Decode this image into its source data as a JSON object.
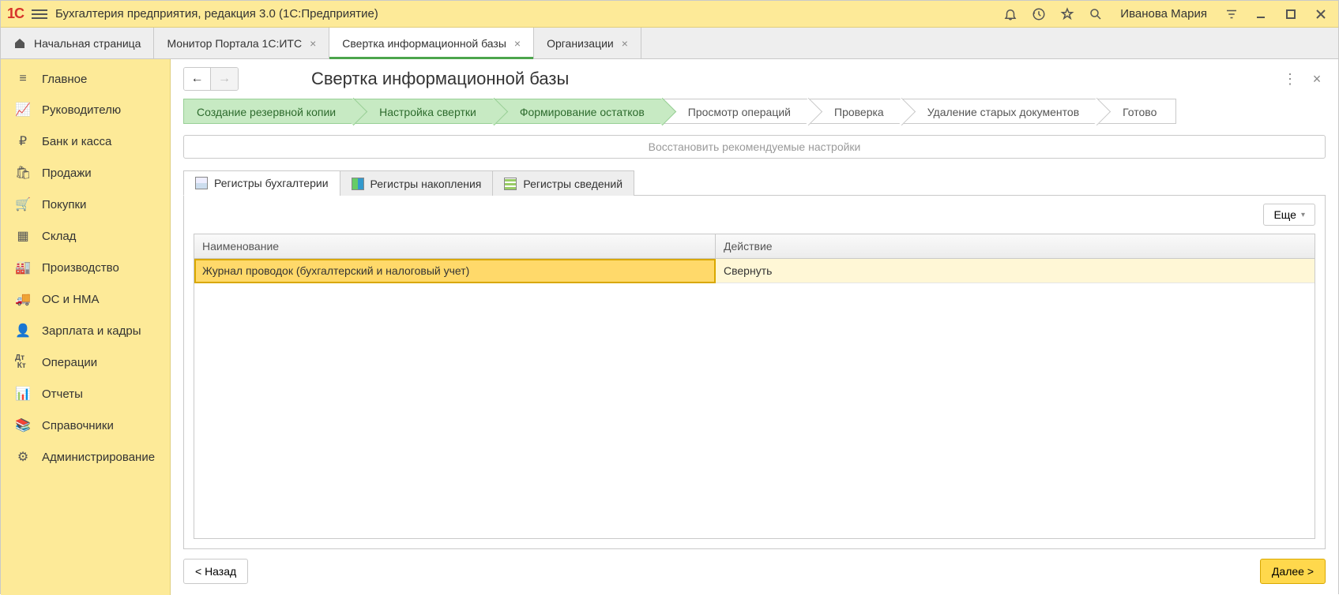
{
  "titlebar": {
    "app_title": "Бухгалтерия предприятия, редакция 3.0  (1С:Предприятие)",
    "user_name": "Иванова Мария"
  },
  "tabs": {
    "home_label": "Начальная страница",
    "items": [
      {
        "label": "Монитор Портала 1С:ИТС",
        "active": false
      },
      {
        "label": "Свертка информационной базы",
        "active": true
      },
      {
        "label": "Организации",
        "active": false
      }
    ]
  },
  "sidebar": {
    "items": [
      {
        "icon": "menu",
        "label": "Главное"
      },
      {
        "icon": "chart",
        "label": "Руководителю"
      },
      {
        "icon": "ruble",
        "label": "Банк и касса"
      },
      {
        "icon": "bag",
        "label": "Продажи"
      },
      {
        "icon": "cart",
        "label": "Покупки"
      },
      {
        "icon": "boxes",
        "label": "Склад"
      },
      {
        "icon": "factory",
        "label": "Производство"
      },
      {
        "icon": "truck",
        "label": "ОС и НМА"
      },
      {
        "icon": "person",
        "label": "Зарплата и кадры"
      },
      {
        "icon": "dtkt",
        "label": "Операции"
      },
      {
        "icon": "bars",
        "label": "Отчеты"
      },
      {
        "icon": "book",
        "label": "Справочники"
      },
      {
        "icon": "gear",
        "label": "Администрирование"
      }
    ]
  },
  "content": {
    "title": "Свертка информационной базы",
    "wizard": [
      {
        "label": "Создание резервной копии",
        "done": true
      },
      {
        "label": "Настройка свертки",
        "done": true
      },
      {
        "label": "Формирование остатков",
        "done": true
      },
      {
        "label": "Просмотр операций",
        "done": false
      },
      {
        "label": "Проверка",
        "done": false
      },
      {
        "label": "Удаление старых документов",
        "done": false
      },
      {
        "label": "Готово",
        "done": false
      }
    ],
    "restore_button": "Восстановить рекомендуемые настройки",
    "subtabs": [
      {
        "label": "Регистры бухгалтерии",
        "active": true
      },
      {
        "label": "Регистры накопления",
        "active": false
      },
      {
        "label": "Регистры сведений",
        "active": false
      }
    ],
    "more_button": "Еще",
    "grid": {
      "headers": {
        "name": "Наименование",
        "action": "Действие"
      },
      "rows": [
        {
          "name": "Журнал проводок (бухгалтерский и налоговый учет)",
          "action": "Свернуть"
        }
      ]
    },
    "back_button": "< Назад",
    "next_button": "Далее >"
  }
}
